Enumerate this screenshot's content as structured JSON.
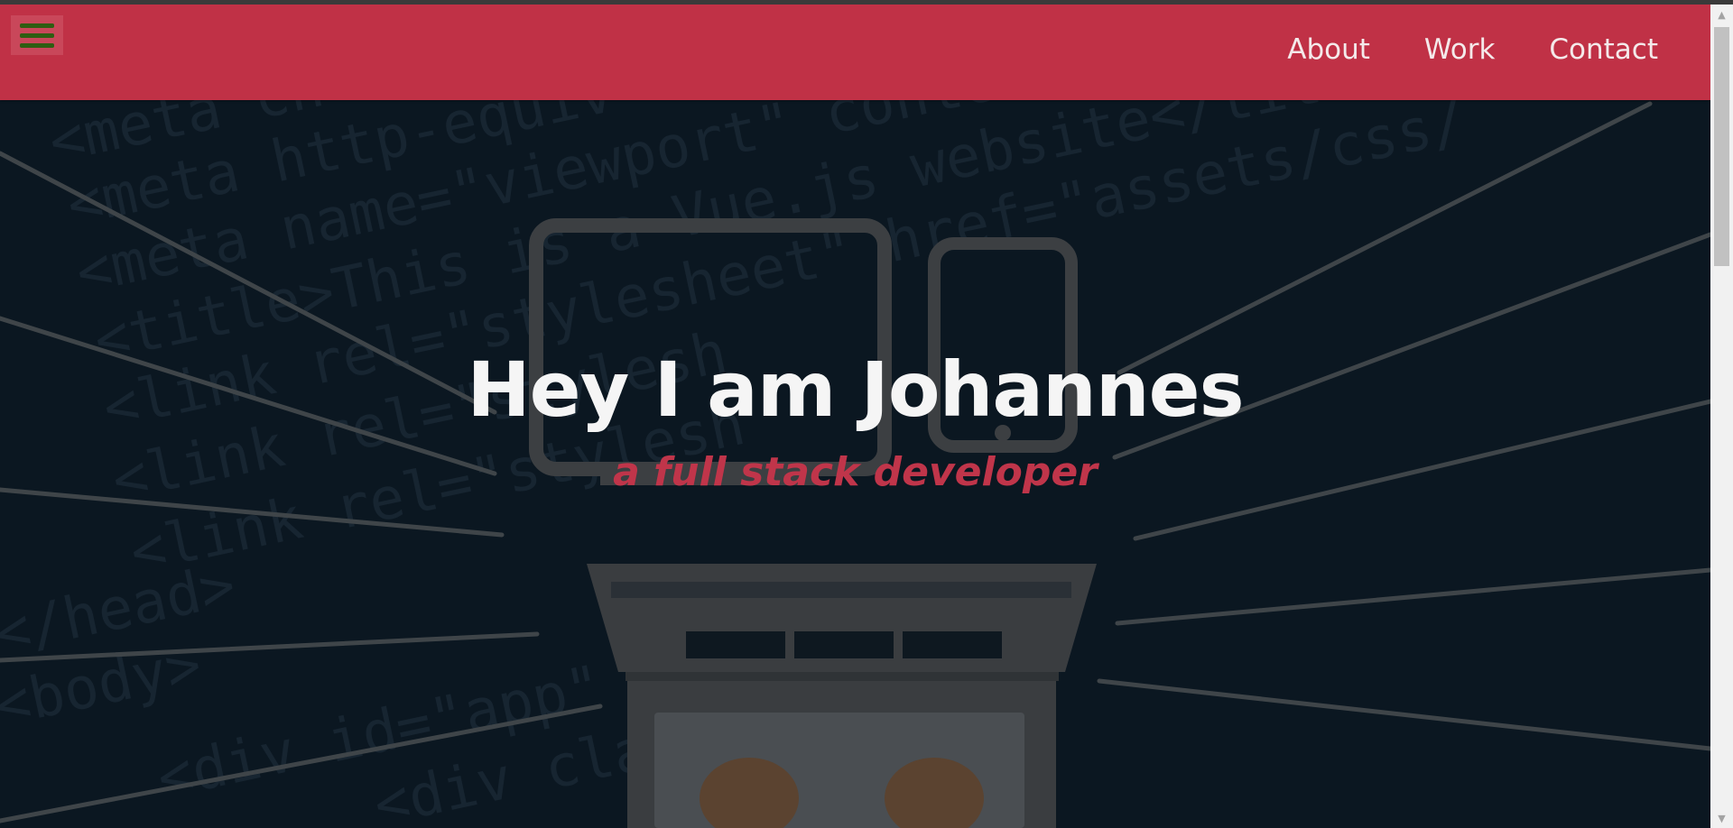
{
  "navbar": {
    "menu_icon": "hamburger-menu-icon",
    "links": [
      {
        "label": "About"
      },
      {
        "label": "Work"
      },
      {
        "label": "Contact"
      }
    ]
  },
  "hero": {
    "title": "Hey I am Johannes",
    "subtitle": "a full stack developer",
    "background_code_lines": [
      "<meta ch",
      "<meta http-equiv=\"X-U",
      "<meta name=\"viewport\" content=\"wi",
      "<title>This is a Vue.js website</title>",
      "<link rel=\"stylesheet\" href=\"assets/css/",
      "<link rel=\"stylesh",
      "<link rel=\"stylesh",
      "</head>",
      "<body>",
      "<div id=\"app\"",
      "<div cla"
    ]
  },
  "colors": {
    "accent": "#c03146",
    "navbar_bg": "#c03146",
    "hero_bg": "#0b1721",
    "title_text": "#f5f5f5",
    "menu_icon": "#2f5d12"
  },
  "scrollbar": {
    "up_icon": "scroll-up-arrow-icon",
    "down_icon": "scroll-down-arrow-icon"
  }
}
